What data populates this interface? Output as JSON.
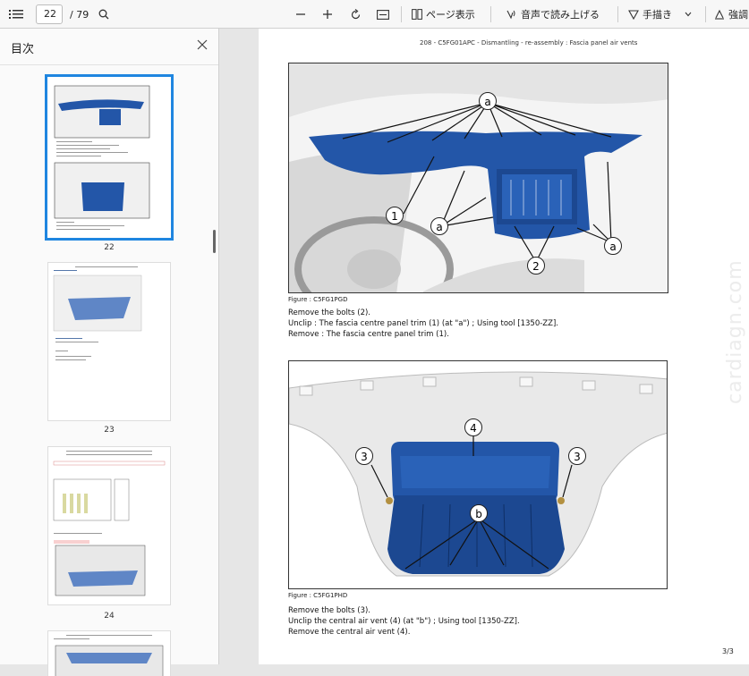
{
  "toolbar": {
    "page_current": "22",
    "page_total": "/ 79",
    "page_view_label": "ページ表示",
    "read_aloud_label": "音声で読み上げる",
    "draw_label": "手描き",
    "highlight_label": "強調"
  },
  "sidebar": {
    "title": "目次",
    "thumbnails": [
      {
        "number": "22"
      },
      {
        "number": "23"
      },
      {
        "number": "24"
      }
    ]
  },
  "page": {
    "header": "208 - C5FG01APC - Dismantling - re-assembly : Fascia panel air vents",
    "figure1": {
      "callouts": [
        "a",
        "1",
        "a",
        "2",
        "a"
      ],
      "caption": "Figure : C5FG1PGD"
    },
    "instructions1": [
      "Remove the bolts (2).",
      "Unclip : The fascia centre panel trim (1) (at \"a\") ; Using tool [1350-ZZ].",
      "Remove : The fascia centre panel trim (1)."
    ],
    "figure2": {
      "callouts": [
        "4",
        "3",
        "3",
        "b"
      ],
      "caption": "Figure : C5FG1PHD"
    },
    "instructions2": [
      "Remove the bolts (3).",
      "Unclip the central air vent (4) (at \"b\") ; Using tool [1350-ZZ].",
      "Remove the central air vent (4)."
    ],
    "watermark": "cardiagn.com",
    "page_number": "3/3"
  },
  "colors": {
    "part_blue": "#2356a8",
    "selected_border": "#1f86e0"
  }
}
